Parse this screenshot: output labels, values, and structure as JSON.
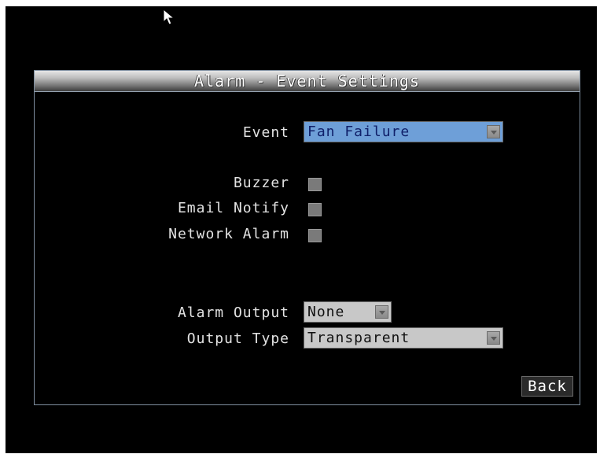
{
  "dialog": {
    "title": "Alarm - Event Settings"
  },
  "fields": {
    "event": {
      "label": "Event",
      "value": "Fan Failure"
    },
    "buzzer": {
      "label": "Buzzer",
      "checked": false
    },
    "email_notify": {
      "label": "Email Notify",
      "checked": false
    },
    "network_alarm": {
      "label": "Network Alarm",
      "checked": false
    },
    "alarm_output": {
      "label": "Alarm Output",
      "value": "None"
    },
    "output_type": {
      "label": "Output Type",
      "value": "Transparent"
    }
  },
  "buttons": {
    "back": "Back"
  },
  "icons": {
    "cursor": "mouse-pointer-icon",
    "dropdown_arrow": "chevron-down-icon"
  },
  "colors": {
    "background": "#000000",
    "selected_field": "#6e9fd8",
    "field": "#c8c8c8",
    "checkbox": "#7a7a7a",
    "border": "#7f8fa0"
  }
}
